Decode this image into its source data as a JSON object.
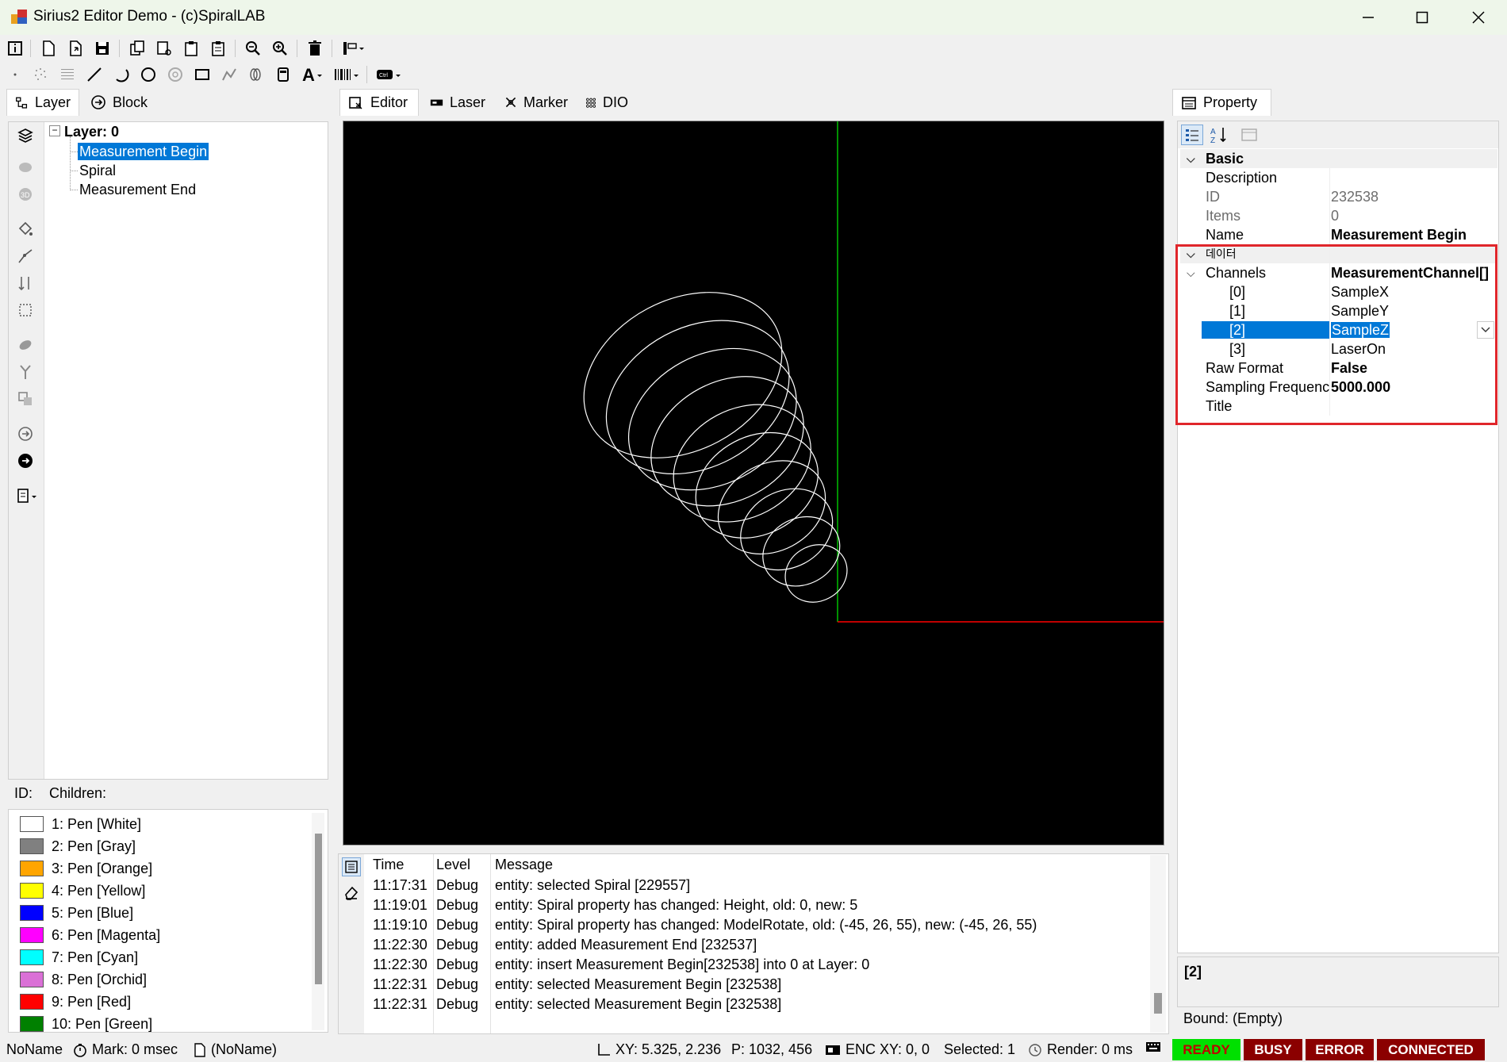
{
  "window": {
    "title": "Sirius2 Editor Demo - (c)SpiralLAB",
    "minimize_glyph": "—",
    "maximize_glyph": "☐",
    "close_glyph": "✕"
  },
  "left_tabs": [
    {
      "label": "Layer"
    },
    {
      "label": "Block"
    }
  ],
  "tree": {
    "root": "Layer: 0",
    "items": [
      "Measurement Begin",
      "Spiral",
      "Measurement End"
    ],
    "selected_index": 0
  },
  "info_bar": {
    "id_label": "ID:",
    "children_label": "Children:"
  },
  "pens": [
    {
      "label": "1: Pen [White]",
      "color": "#ffffff"
    },
    {
      "label": "2: Pen [Gray]",
      "color": "#808080"
    },
    {
      "label": "3: Pen [Orange]",
      "color": "#ffa500"
    },
    {
      "label": "4: Pen [Yellow]",
      "color": "#ffff00"
    },
    {
      "label": "5: Pen [Blue]",
      "color": "#0000ff"
    },
    {
      "label": "6: Pen [Magenta]",
      "color": "#ff00ff"
    },
    {
      "label": "7: Pen [Cyan]",
      "color": "#00ffff"
    },
    {
      "label": "8: Pen [Orchid]",
      "color": "#da70d6"
    },
    {
      "label": "9: Pen [Red]",
      "color": "#ff0000"
    },
    {
      "label": "10: Pen [Green]",
      "color": "#008000"
    }
  ],
  "center_tabs": [
    {
      "label": "Editor"
    },
    {
      "label": "Laser"
    },
    {
      "label": "Marker"
    },
    {
      "label": "DIO"
    }
  ],
  "canvas": {
    "background": "#000000",
    "axis_y_color": "#00c000",
    "axis_x_color": "#ff0000",
    "shape_color": "#ffffff"
  },
  "log": {
    "headers": {
      "time": "Time",
      "level": "Level",
      "message": "Message"
    },
    "rows": [
      {
        "time": "11:17:31",
        "level": "Debug",
        "message": "entity: selected Spiral [229557]"
      },
      {
        "time": "11:19:01",
        "level": "Debug",
        "message": "entity: Spiral property has changed: Height, old: 0, new: 5"
      },
      {
        "time": "11:19:10",
        "level": "Debug",
        "message": "entity: Spiral property has changed: ModelRotate, old: (-45, 26, 55), new: (-45, 26, 55)"
      },
      {
        "time": "11:22:30",
        "level": "Debug",
        "message": "entity: added Measurement End [232537]"
      },
      {
        "time": "11:22:30",
        "level": "Debug",
        "message": "entity: insert Measurement Begin[232538] into 0 at Layer: 0"
      },
      {
        "time": "11:22:31",
        "level": "Debug",
        "message": "entity: selected Measurement Begin [232538]"
      },
      {
        "time": "11:22:31",
        "level": "Debug",
        "message": "entity: selected Measurement Begin [232538]"
      }
    ]
  },
  "property": {
    "tab_label": "Property",
    "basic": {
      "category": "Basic",
      "rows": [
        {
          "key": "Description",
          "value": ""
        },
        {
          "key": "ID",
          "value": "232538"
        },
        {
          "key": "Items",
          "value": "0"
        },
        {
          "key": "Name",
          "value": "Measurement Begin"
        }
      ]
    },
    "data": {
      "category": "데이터",
      "channels_key": "Channels",
      "channels_value": "MeasurementChannel[]",
      "channels": [
        {
          "key": "[0]",
          "value": "SampleX"
        },
        {
          "key": "[1]",
          "value": "SampleY"
        },
        {
          "key": "[2]",
          "value": "SampleZ"
        },
        {
          "key": "[3]",
          "value": "LaserOn"
        }
      ],
      "selected_channel": 2,
      "rows": [
        {
          "key": "Raw Format",
          "value": "False"
        },
        {
          "key": "Sampling Frequenc",
          "value": "5000.000"
        },
        {
          "key": "Title",
          "value": ""
        }
      ]
    },
    "description_title": "[2]",
    "bound_label": "Bound: (Empty)",
    "highlight_color": "#e0262b"
  },
  "status": {
    "name": "NoName",
    "mark": "Mark: 0 msec",
    "doc": "(NoName)",
    "xy": "XY: 5.325, 2.236",
    "p": "P: 1032, 456",
    "enc": "ENC XY: 0, 0",
    "selected": "Selected: 1",
    "render": "Render: 0 ms",
    "ready": {
      "label": "READY",
      "color": "#00e000",
      "text_color": "#c00000"
    },
    "busy": {
      "label": "BUSY",
      "color": "#8b0000"
    },
    "error": {
      "label": "ERROR",
      "color": "#8b0000"
    },
    "connected": {
      "label": "CONNECTED",
      "color": "#8b0000"
    }
  }
}
